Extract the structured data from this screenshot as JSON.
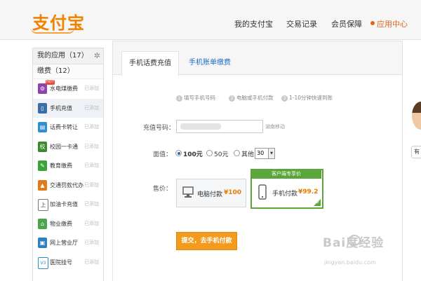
{
  "header": {
    "logo": "支付宝",
    "nav": [
      {
        "label": "我的支付宝"
      },
      {
        "label": "交易记录"
      },
      {
        "label": "会员保障"
      },
      {
        "label": "应用中心"
      }
    ],
    "accent": "#e3661a"
  },
  "sidebar": {
    "title": "我的应用（17）",
    "gear_icon": "gear-icon",
    "section": "缴费（12）",
    "items": [
      {
        "label": "水电煤缴费",
        "status": "已添加",
        "icon": "utility-icon",
        "color": "#8e44ad",
        "badge": "HOT"
      },
      {
        "label": "手机充值",
        "status": "已添加",
        "icon": "phone-icon",
        "color": "#3b6ea8"
      },
      {
        "label": "话费卡转让",
        "status": "已添加",
        "icon": "card-icon",
        "color": "#2f8fd0"
      },
      {
        "label": "校园一卡通",
        "status": "已添加",
        "icon": "school-icon",
        "color": "#3c8a2e",
        "glyph": "校"
      },
      {
        "label": "教育缴费",
        "status": "已添加",
        "icon": "education-icon",
        "color": "#3aa33a"
      },
      {
        "label": "交通罚款代办",
        "status": "已添加",
        "icon": "traffic-icon",
        "color": "#e07b1b"
      },
      {
        "label": "加油卡充值",
        "status": "已添加",
        "icon": "fuel-icon",
        "color": "#555555",
        "glyph": "上"
      },
      {
        "label": "物业缴费",
        "status": "已添加",
        "icon": "property-icon",
        "color": "#4aa64a"
      },
      {
        "label": "网上营业厅",
        "status": "已添加",
        "icon": "hall-icon",
        "color": "#2f7fc4"
      },
      {
        "label": "医院挂号",
        "status": "已添加",
        "icon": "hospital-icon",
        "color": "#2a8bc9",
        "glyph": "V3"
      }
    ]
  },
  "tabs": [
    {
      "label": "手机话费充值",
      "active": true
    },
    {
      "label": "手机账单缴费",
      "active": false
    }
  ],
  "steps": [
    {
      "num": "1",
      "label": "填写手机号码"
    },
    {
      "num": "2",
      "label": "电脑或手机付款"
    },
    {
      "num": "3",
      "label": "1-10分钟快速到账"
    }
  ],
  "form": {
    "phone_label": "充值号码：",
    "carrier": "湖南移动",
    "amount_label": "面值：",
    "amounts": [
      {
        "label": "100元",
        "selected": true
      },
      {
        "label": "50元",
        "selected": false
      },
      {
        "label": "其他",
        "selected": false
      }
    ],
    "other_value": "30",
    "price_label": "售价：",
    "pay_pc": {
      "label": "电脑付款",
      "price": "¥100"
    },
    "pay_mobile": {
      "label": "手机付款",
      "price": "¥99.2",
      "promo": "客户端专享价"
    },
    "submit": "提交，去手机付款"
  },
  "side_widget": {
    "button": "有"
  },
  "watermark": {
    "text": "Bai度经验",
    "sub": "jingyan.baidu.com"
  }
}
